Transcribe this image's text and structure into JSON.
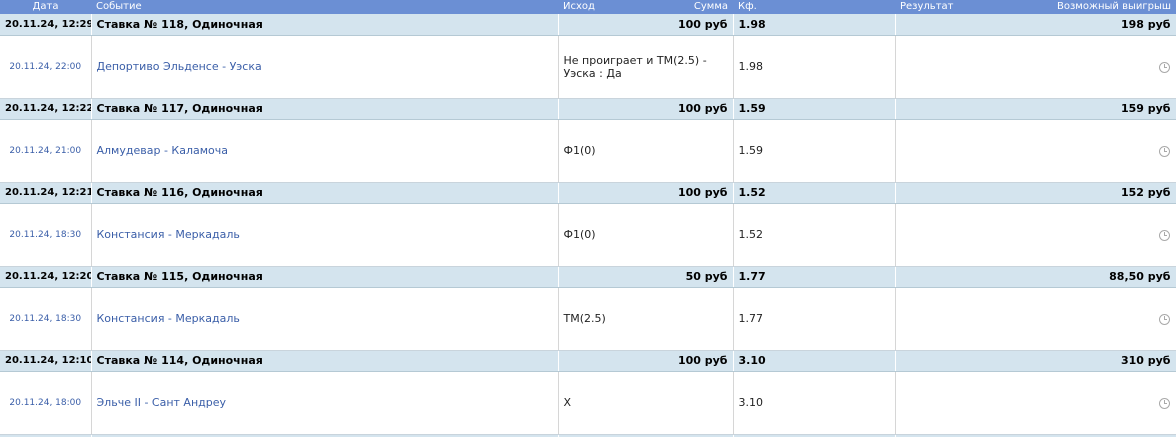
{
  "headers": {
    "date": "Дата",
    "event": "Событие",
    "outcome": "Исход",
    "amount": "Сумма",
    "coef": "Кф.",
    "result": "Результат",
    "win": "Возможный выигрыш"
  },
  "status_icon": "clock-icon",
  "bets": [
    {
      "placed": "20.11.24, 12:29",
      "title": "Ставка № 118, Одиночная",
      "amount": "100 руб",
      "coef": "1.98",
      "win": "198 руб",
      "event_date": "20.11.24, 22:00",
      "event": "Депортиво Эльденсе - Уэска",
      "outcome": "Не проиграет и ТМ(2.5) - Уэска : Да",
      "event_coef": "1.98"
    },
    {
      "placed": "20.11.24, 12:22",
      "title": "Ставка № 117, Одиночная",
      "amount": "100 руб",
      "coef": "1.59",
      "win": "159 руб",
      "event_date": "20.11.24, 21:00",
      "event": "Алмудевар - Каламоча",
      "outcome": "Ф1(0)",
      "event_coef": "1.59"
    },
    {
      "placed": "20.11.24, 12:21",
      "title": "Ставка № 116, Одиночная",
      "amount": "100 руб",
      "coef": "1.52",
      "win": "152 руб",
      "event_date": "20.11.24, 18:30",
      "event": "Констансия - Меркадаль",
      "outcome": "Ф1(0)",
      "event_coef": "1.52"
    },
    {
      "placed": "20.11.24, 12:20",
      "title": "Ставка № 115, Одиночная",
      "amount": "50 руб",
      "coef": "1.77",
      "win": "88,50 руб",
      "event_date": "20.11.24, 18:30",
      "event": "Констансия - Меркадаль",
      "outcome": "ТМ(2.5)",
      "event_coef": "1.77"
    },
    {
      "placed": "20.11.24, 12:10",
      "title": "Ставка № 114, Одиночная",
      "amount": "100 руб",
      "coef": "3.10",
      "win": "310 руб",
      "event_date": "20.11.24, 18:00",
      "event": "Эльче II - Сант Андреу",
      "outcome": "Х",
      "event_coef": "3.10"
    }
  ]
}
